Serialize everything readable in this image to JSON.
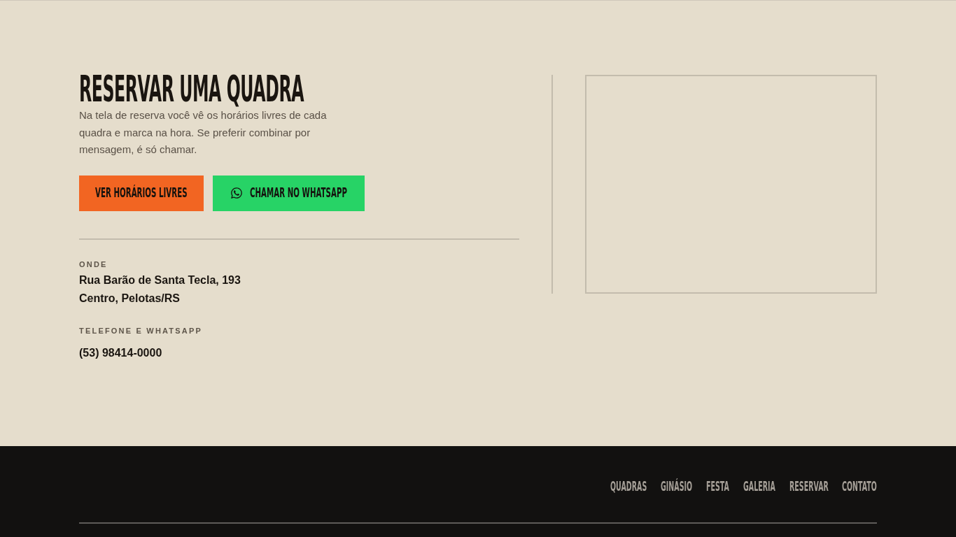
{
  "booking": {
    "title": "RESERVAR UMA QUADRA",
    "description": "Na tela de reserva você vê os horários livres de cada quadra e marca na hora. Se preferir combinar por mensagem, é só chamar.",
    "buttons": [
      {
        "label": "VER HORÁRIOS LIVRES",
        "kind": "primary"
      },
      {
        "label": "CHAMAR NO WHATSAPP",
        "kind": "whatsapp"
      }
    ],
    "details": [
      {
        "label": "ONDE",
        "lines": [
          "Rua Barão de Santa Tecla, 193",
          "Centro, Pelotas/RS"
        ]
      },
      {
        "label": "TELEFONE E WHATSAPP",
        "lines": [
          "(53) 98414-0000"
        ]
      }
    ]
  },
  "footer": {
    "nav": [
      "QUADRAS",
      "GINÁSIO",
      "FESTA",
      "GALERIA",
      "RESERVAR",
      "CONTATO"
    ]
  }
}
